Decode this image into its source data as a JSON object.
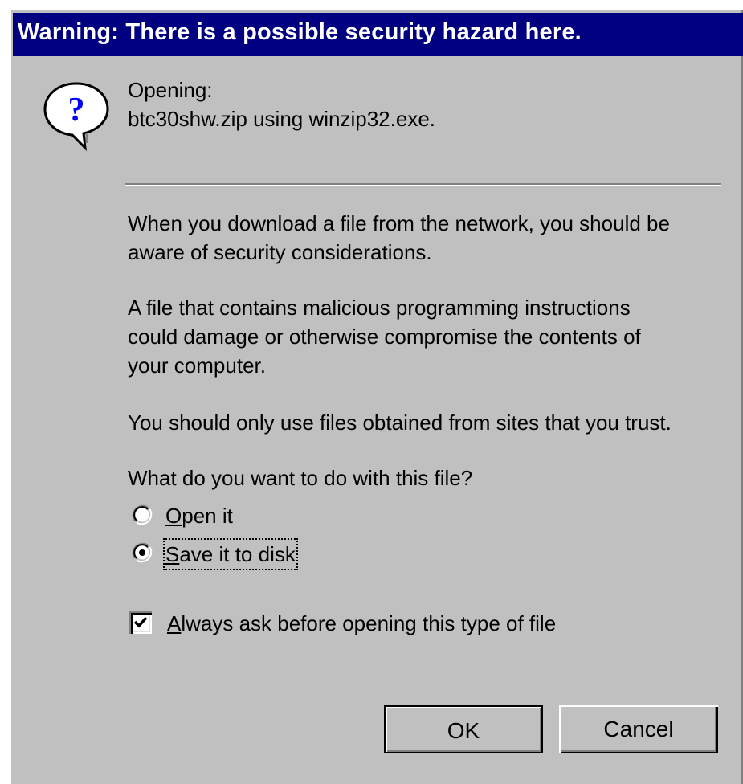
{
  "dialog": {
    "title": "Warning:  There is a possible security hazard here.",
    "icon": "question-balloon-icon",
    "opening_label": "Opening:",
    "opening_file": "btc30shw.zip using winzip32.exe.",
    "paragraph1": [
      "When you download a file from the network, you should be",
      "aware of security considerations."
    ],
    "paragraph2": [
      "A file that contains malicious programming instructions",
      "could damage or otherwise compromise the contents of",
      "your computer."
    ],
    "paragraph3": "You should only use files obtained from sites that you trust.",
    "question": "What do you want to do with this file?",
    "options": [
      {
        "mnemonic": "O",
        "rest": "pen it",
        "selected": false
      },
      {
        "mnemonic": "S",
        "rest": "ave it to disk",
        "selected": true
      }
    ],
    "always_ask": {
      "mnemonic": "A",
      "rest": "lways ask before opening this type of file",
      "checked": true
    },
    "buttons": {
      "ok": "OK",
      "cancel": "Cancel"
    }
  },
  "colors": {
    "titlebar": "#000080",
    "face": "#c0c0c0"
  }
}
